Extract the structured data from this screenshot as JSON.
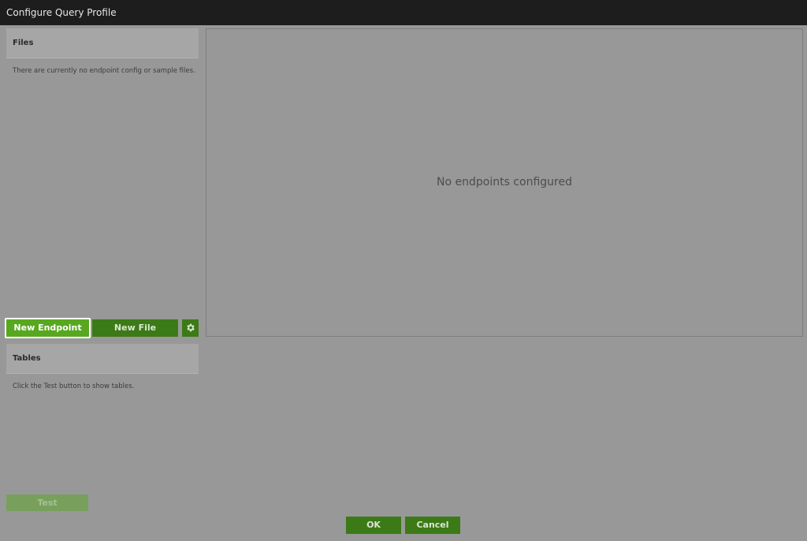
{
  "window": {
    "title": "Configure Query Profile"
  },
  "files_panel": {
    "header": "Files",
    "empty_text": "There are currently no endpoint config or sample files."
  },
  "toolbar": {
    "new_endpoint_label": "New Endpoint",
    "new_file_label": "New File",
    "settings_icon": "gear-icon"
  },
  "tables_panel": {
    "header": "Tables",
    "hint_text": "Click the Test button to show tables."
  },
  "preview": {
    "empty_message": "No endpoints configured"
  },
  "actions": {
    "test_label": "Test",
    "ok_label": "OK",
    "cancel_label": "Cancel"
  },
  "colors": {
    "titlebar": "#1d1d1d",
    "background": "#989898",
    "accent_green": "#3c7a17",
    "active_green": "#58a81f"
  }
}
